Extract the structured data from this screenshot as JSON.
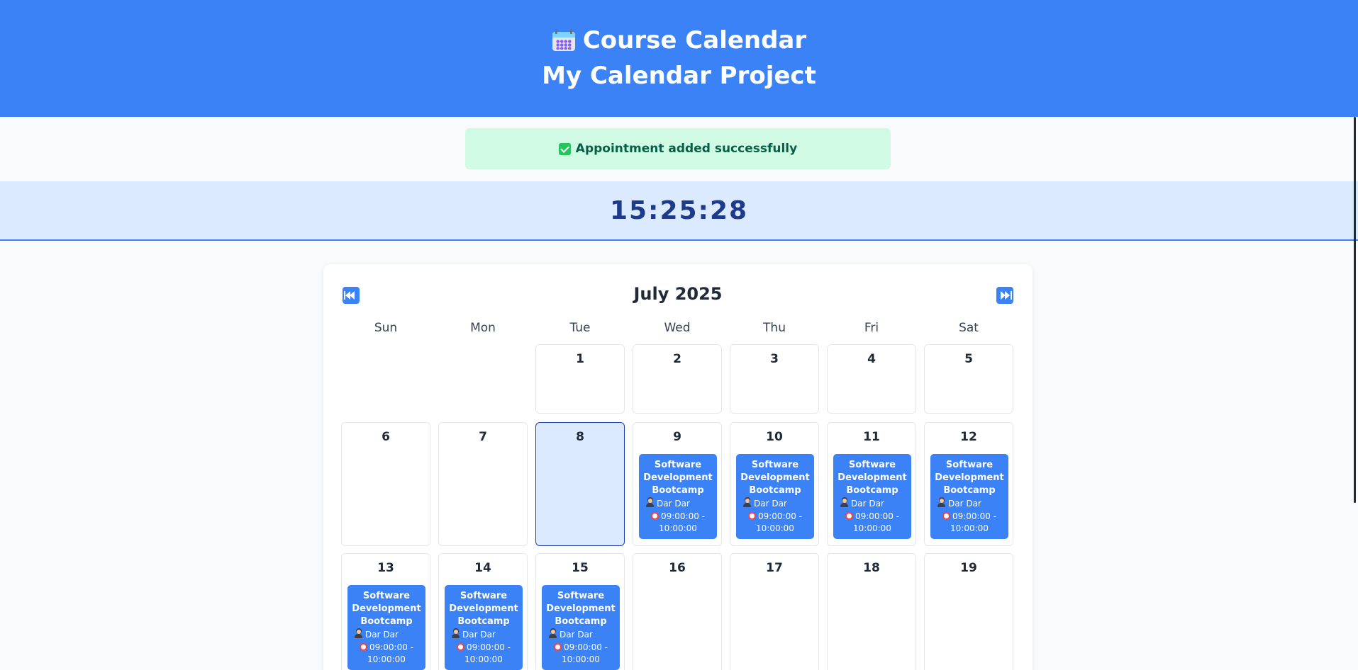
{
  "header": {
    "title": "Course Calendar",
    "subtitle": "My Calendar Project",
    "icon": "calendar-emoji",
    "bg_color": "#3b82f6"
  },
  "alert": {
    "message": "Appointment added successfully",
    "icon": "check-box-icon",
    "bg_color": "#d1fae5"
  },
  "clock": {
    "time": "15:25:28"
  },
  "calendar": {
    "month_label": "July 2025",
    "prev_icon": "rewind-icon",
    "next_icon": "fast-forward-icon",
    "weekdays": [
      "Sun",
      "Mon",
      "Tue",
      "Wed",
      "Thu",
      "Fri",
      "Sat"
    ],
    "today": 8,
    "days": [
      {
        "n": "1"
      },
      {
        "n": "2"
      },
      {
        "n": "3"
      },
      {
        "n": "4"
      },
      {
        "n": "5"
      },
      {
        "n": "6"
      },
      {
        "n": "7"
      },
      {
        "n": "8"
      },
      {
        "n": "9"
      },
      {
        "n": "10"
      },
      {
        "n": "11"
      },
      {
        "n": "12"
      },
      {
        "n": "13"
      },
      {
        "n": "14"
      },
      {
        "n": "15"
      },
      {
        "n": "16"
      },
      {
        "n": "17"
      },
      {
        "n": "18"
      },
      {
        "n": "19"
      }
    ],
    "events": [
      {
        "day": "9",
        "title": "Software Development Bootcamp",
        "teacher": "Dar Dar",
        "time": "09:00:00 - 10:00:00"
      },
      {
        "day": "10",
        "title": "Software Development Bootcamp",
        "teacher": "Dar Dar",
        "time": "09:00:00 - 10:00:00"
      },
      {
        "day": "11",
        "title": "Software Development Bootcamp",
        "teacher": "Dar Dar",
        "time": "09:00:00 - 10:00:00"
      },
      {
        "day": "12",
        "title": "Software Development Bootcamp",
        "teacher": "Dar Dar",
        "time": "09:00:00 - 10:00:00"
      },
      {
        "day": "13",
        "title": "Software Development Bootcamp",
        "teacher": "Dar Dar",
        "time": "09:00:00 - 10:00:00"
      },
      {
        "day": "14",
        "title": "Software Development Bootcamp",
        "teacher": "Dar Dar",
        "time": "09:00:00 - 10:00:00"
      },
      {
        "day": "15",
        "title": "Software Development Bootcamp",
        "teacher": "Dar Dar",
        "time": "09:00:00 - 10:00:00"
      }
    ]
  }
}
